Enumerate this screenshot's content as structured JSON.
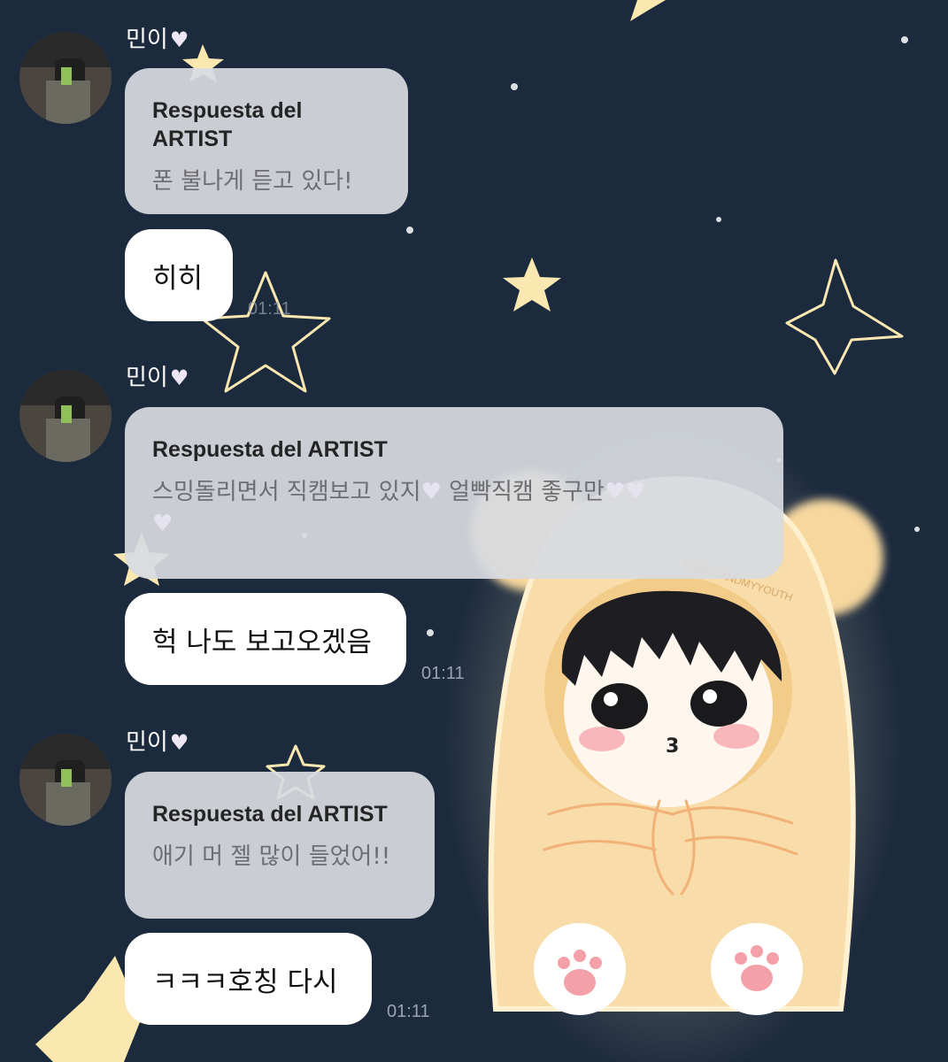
{
  "chat": {
    "blocks": [
      {
        "sender": "민이",
        "reply_header": "Respuesta del ARTIST",
        "reply_text": "폰 불나게 듣고 있다!",
        "message": "히히",
        "time": "01:11"
      },
      {
        "sender": "민이",
        "reply_header": "Respuesta del ARTIST",
        "reply_text_1": "스밍돌리면서 직캠보고 있지",
        "reply_text_2": " 얼빡직캠 좋구만",
        "message": "헉 나도 보고오겠음",
        "time": "01:11"
      },
      {
        "sender": "민이",
        "reply_header": "Respuesta del ARTIST",
        "reply_text": "애기 머 젤 많이 들었어!!",
        "message": "ㅋㅋㅋ호칭 다시",
        "time": "01:11"
      }
    ]
  },
  "illustration": {
    "watermark": "KNOCKANDMYYOUTH",
    "mouth_glyph": "3"
  },
  "icons": {
    "heart": "white-heart-icon",
    "avatar": "user-avatar-photo"
  },
  "colors": {
    "background": "#1c2a3e",
    "star": "#fbe7b0",
    "reply_bubble": "#d7dae0",
    "message_bubble": "#ffffff",
    "heart": "#ece6f5"
  }
}
